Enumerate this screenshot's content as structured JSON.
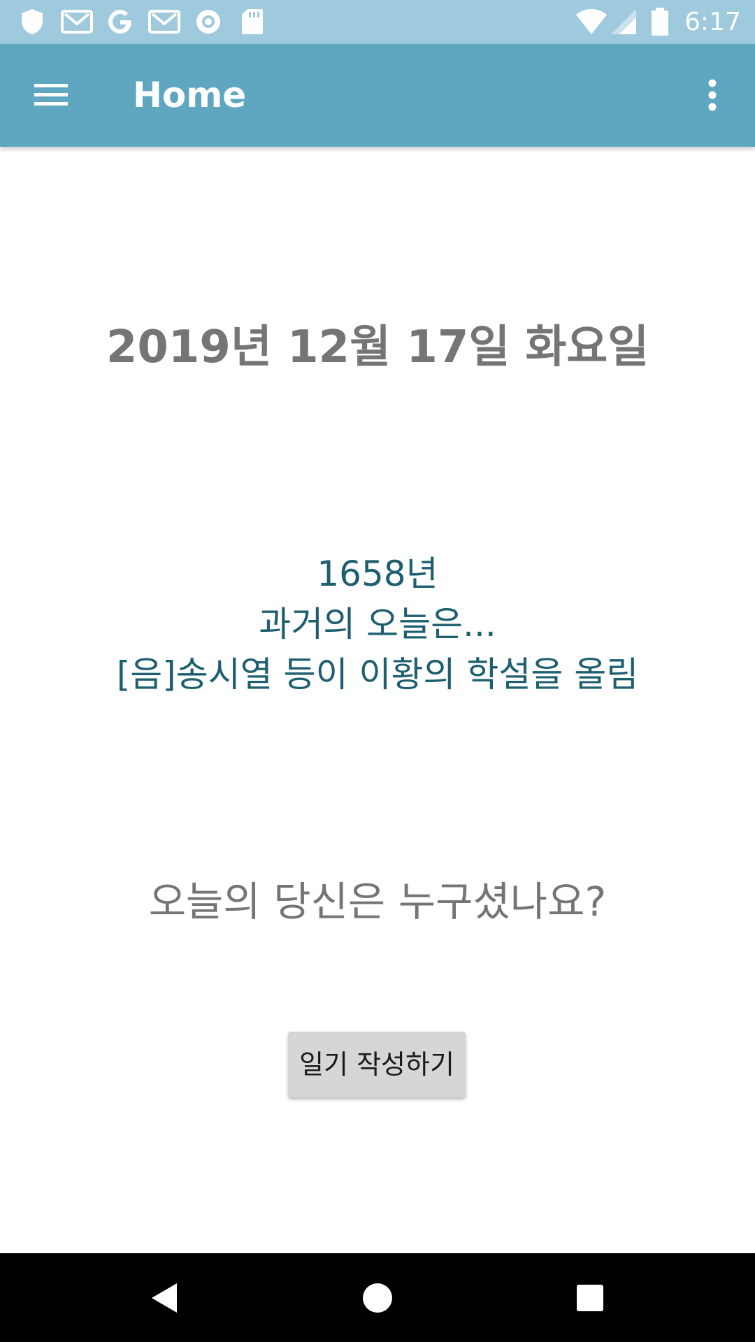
{
  "status_bar": {
    "time": "6:17",
    "left_icons": [
      "shield-icon",
      "gmail-icon",
      "google-icon",
      "gmail-icon",
      "record-icon",
      "sd-card-icon"
    ],
    "right_icons": [
      "wifi-icon",
      "signal-icon",
      "battery-icon"
    ],
    "background": "#9fcadd"
  },
  "app_bar": {
    "title": "Home",
    "background": "#5fa6c0"
  },
  "main": {
    "date": "2019년 12월 17일 화요일",
    "history": {
      "year": "1658년",
      "intro": "과거의 오늘은...",
      "event": "[음]송시열 등이 이황의 학설을 올림",
      "color": "#1d5f6e"
    },
    "question": "오늘의 당신은 누구셨나요?",
    "write_button_label": "일기 작성하기"
  },
  "nav_bar": {
    "buttons": [
      "back-icon",
      "home-icon",
      "recents-icon"
    ]
  }
}
